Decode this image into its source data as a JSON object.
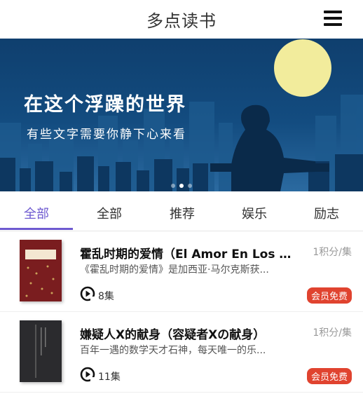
{
  "header": {
    "title": "多点读书",
    "menu_icon": "hamburger-menu-icon"
  },
  "banner": {
    "line1": "在这个浮躁的世界",
    "line2": "有些文字需要你静下心来看",
    "sky_color": "#134c80",
    "moon_color": "#f2ec9c"
  },
  "tabs": [
    {
      "label": "全部",
      "active": true
    },
    {
      "label": "全部",
      "active": false
    },
    {
      "label": "推荐",
      "active": false
    },
    {
      "label": "娱乐",
      "active": false
    },
    {
      "label": "励志",
      "active": false
    }
  ],
  "accent_color": "#6e5ad0",
  "books": [
    {
      "title": "霍乱时期的爱情（El Amor En Los T...",
      "desc": "《霍乱时期的爱情》是加西亚·马尔克斯获...",
      "price": "1积分/集",
      "episodes": "8集",
      "badge": "会员免费"
    },
    {
      "title": "嫌疑人X的献身（容疑者Xの献身）",
      "desc": "百年一遇的数学天才石神，每天唯一的乐...",
      "price": "1积分/集",
      "episodes": "11集",
      "badge": "会员免费"
    }
  ],
  "badge_color": "#e0432f"
}
